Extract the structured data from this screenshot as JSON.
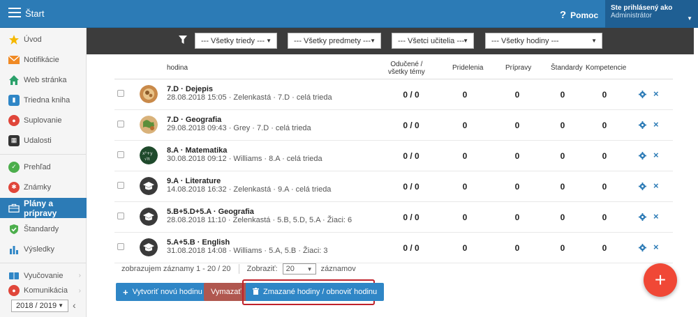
{
  "header": {
    "title": "Štart",
    "help_label": "Pomoc",
    "user_label": "Ste prihlásený ako",
    "user_role": "Administrátor"
  },
  "sidebar": {
    "items": [
      {
        "label": "Úvod",
        "icon": "star-icon",
        "color": "#f5b800"
      },
      {
        "label": "Notifikácie",
        "icon": "mail-icon",
        "color": "#f08a24"
      },
      {
        "label": "Web stránka",
        "icon": "home-icon",
        "color": "#2aa06a"
      },
      {
        "label": "Triedna kniha",
        "icon": "book-icon",
        "color": "#2f86c6"
      },
      {
        "label": "Suplovanie",
        "icon": "person-icon",
        "color": "#e0463a"
      },
      {
        "label": "Udalosti",
        "icon": "calendar-icon",
        "color": "#333333"
      },
      {
        "label": "Prehľad",
        "icon": "check-circle-icon",
        "color": "#4cae4c"
      },
      {
        "label": "Známky",
        "icon": "grades-icon",
        "color": "#e0463a"
      },
      {
        "label": "Plány a prípravy",
        "icon": "briefcase-icon",
        "color": "#ffffff"
      },
      {
        "label": "Štandardy",
        "icon": "shield-check-icon",
        "color": "#4cae4c"
      },
      {
        "label": "Výsledky",
        "icon": "bar-chart-icon",
        "color": "#2f86c6"
      },
      {
        "label": "Vyučovanie",
        "icon": "books-icon",
        "color": "#2f86c6"
      },
      {
        "label": "Komunikácia",
        "icon": "chat-icon",
        "color": "#e0463a"
      }
    ],
    "year": "2018 / 2019"
  },
  "filters": {
    "classes": "--- Všetky triedy ---",
    "subjects": "--- Všetky predmety ---",
    "teachers": "--- Všetci učitelia ---",
    "lessons": "--- Všetky hodiny ---"
  },
  "table": {
    "headers": {
      "lesson": "hodina",
      "taught_1": "Odučené /",
      "taught_2": "všetky témy",
      "assignments": "Pridelenia",
      "preparations": "Prípravy",
      "standards": "Štandardy",
      "competences": "Kompetencie"
    },
    "rows": [
      {
        "title": "7.D · Dejepis",
        "subtitle": "28.08.2018 15:05 · Zelenkastá · 7.D · celá trieda",
        "taught": "0 / 0",
        "assignments": "0",
        "preparations": "0",
        "standards": "0",
        "competences": "0",
        "avatar": "history-avatar"
      },
      {
        "title": "7.D · Geografia",
        "subtitle": "29.08.2018 09:43 · Grey · 7.D · celá trieda",
        "taught": "0 / 0",
        "assignments": "0",
        "preparations": "0",
        "standards": "0",
        "competences": "0",
        "avatar": "geography-avatar"
      },
      {
        "title": "8.A · Matematika",
        "subtitle": "30.08.2018 09:12 · Williams · 8.A · celá trieda",
        "taught": "0 / 0",
        "assignments": "0",
        "preparations": "0",
        "standards": "0",
        "competences": "0",
        "avatar": "math-avatar"
      },
      {
        "title": "9.A · Literature",
        "subtitle": "14.08.2018 16:32 · Zelenkastá · 9.A · celá trieda",
        "taught": "0 / 0",
        "assignments": "0",
        "preparations": "0",
        "standards": "0",
        "competences": "0",
        "avatar": "graduation-cap-avatar"
      },
      {
        "title": "5.B+5.D+5.A · Geografia",
        "subtitle": "28.08.2018 11:10 · Zelenkastá · 5.B, 5.D, 5.A · Žiaci: 6",
        "taught": "0 / 0",
        "assignments": "0",
        "preparations": "0",
        "standards": "0",
        "competences": "0",
        "avatar": "graduation-cap-avatar"
      },
      {
        "title": "5.A+5.B · English",
        "subtitle": "31.08.2018 14:08 · Williams · 5.A, 5.B · Žiaci: 3",
        "taught": "0 / 0",
        "assignments": "0",
        "preparations": "0",
        "standards": "0",
        "competences": "0",
        "avatar": "graduation-cap-avatar"
      }
    ]
  },
  "pager": {
    "summary": "zobrazujem záznamy 1 - 20 / 20",
    "show_label": "Zobraziť:",
    "per_page": "20",
    "records_label": "záznamov"
  },
  "actions": {
    "create": "Vytvoriť novú hodinu",
    "delete": "Vymazať",
    "deleted": "Zmazané hodiny / obnoviť hodinu",
    "fab": "+"
  },
  "colors": {
    "primary": "#2c7bb6",
    "filter_bar": "#3c3c3c",
    "danger": "#b0574f",
    "fab": "#f04836",
    "highlight": "#c0222b"
  }
}
